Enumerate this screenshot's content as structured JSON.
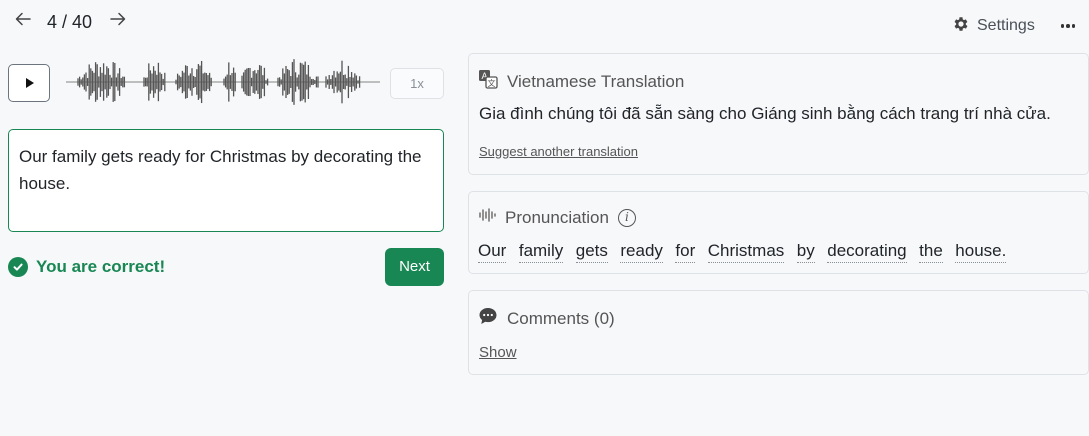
{
  "nav": {
    "prev_icon": "arrow-left-icon",
    "next_icon": "arrow-right-icon",
    "counter": "4 / 40",
    "settings_label": "Settings",
    "more_icon": "more-icon"
  },
  "player": {
    "play_icon": "play-icon",
    "speed_label": "1x"
  },
  "answer": {
    "text": "Our family gets ready for Christmas by decorating the house."
  },
  "result": {
    "message": "You are correct!",
    "next_label": "Next"
  },
  "translation": {
    "heading": "Vietnamese Translation",
    "text": "Gia đình chúng tôi đã sẵn sàng cho Giáng sinh bằng cách trang trí nhà cửa.",
    "suggest_label": "Suggest another translation"
  },
  "pronunciation": {
    "heading": "Pronunciation",
    "words": [
      "Our",
      "family",
      "gets",
      "ready",
      "for",
      "Christmas",
      "by",
      "decorating",
      "the",
      "house."
    ]
  },
  "comments": {
    "heading": "Comments (0)",
    "show_label": "Show"
  },
  "colors": {
    "accent": "#198754",
    "background": "#f7f8fa"
  }
}
